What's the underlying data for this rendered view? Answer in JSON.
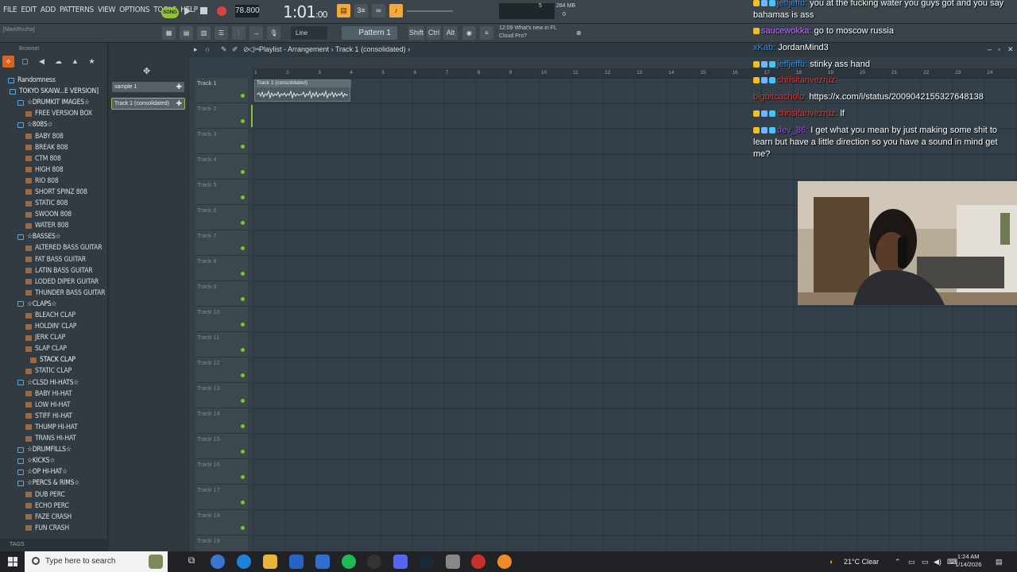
{
  "menu": [
    "FILE",
    "EDIT",
    "ADD",
    "PATTERNS",
    "VIEW",
    "OPTIONS",
    "TOOLS",
    "HELP"
  ],
  "transport": {
    "song_label": "SONG",
    "tempo": "78.800",
    "time": "1:01",
    "time_sub": ":00",
    "meter_value": "5",
    "memory": "284 MB",
    "meter_zero": "0"
  },
  "subbar": {
    "hint": "[MarkRocha]",
    "snap": "Line",
    "pattern": "Pattern 1",
    "key_shift": "Shift",
    "key_ctrl": "Ctrl",
    "key_alt": "Alt",
    "news_time": "12:09",
    "news_line1": "What's new in FL",
    "news_line2": "Cloud Pro?"
  },
  "browser": {
    "title": "Browser",
    "footer": "TAGS",
    "tree": [
      {
        "label": "Randomness",
        "type": "folder-root"
      },
      {
        "label": "TOKYO SKAIW...E VERSION]",
        "type": "folder"
      },
      {
        "label": "☆DRUMKIT IMAGES☆",
        "type": "folder"
      },
      {
        "label": "FREE VERSION BOX",
        "type": "item"
      },
      {
        "label": "☆808S☆",
        "type": "folder"
      },
      {
        "label": "BABY 808",
        "type": "item"
      },
      {
        "label": "BREAK 808",
        "type": "item"
      },
      {
        "label": "CTM 808",
        "type": "item"
      },
      {
        "label": "HIGH 808",
        "type": "item"
      },
      {
        "label": "RIO 808",
        "type": "item"
      },
      {
        "label": "SHORT SPINZ 808",
        "type": "item"
      },
      {
        "label": "STATIC 808",
        "type": "item"
      },
      {
        "label": "SWOON 808",
        "type": "item"
      },
      {
        "label": "WATER 808",
        "type": "item"
      },
      {
        "label": "☆BASSES☆",
        "type": "folder"
      },
      {
        "label": "ALTERED BASS GUITAR",
        "type": "item"
      },
      {
        "label": "FAT BASS GUITAR",
        "type": "item"
      },
      {
        "label": "LATIN BASS GUITAR",
        "type": "item"
      },
      {
        "label": "LODED DIPER GUITAR",
        "type": "item"
      },
      {
        "label": "THUNDER BASS GUITAR",
        "type": "item"
      },
      {
        "label": "☆CLAPS☆",
        "type": "folder"
      },
      {
        "label": "BLEACH CLAP",
        "type": "item"
      },
      {
        "label": "HOLDIN' CLAP",
        "type": "item"
      },
      {
        "label": "JERK CLAP",
        "type": "item"
      },
      {
        "label": "SLAP CLAP",
        "type": "item"
      },
      {
        "label": "STACK CLAP",
        "type": "item-selected"
      },
      {
        "label": "STATIC CLAP",
        "type": "item"
      },
      {
        "label": "☆CLSD HI-HATS☆",
        "type": "folder"
      },
      {
        "label": "BABY HI-HAT",
        "type": "item"
      },
      {
        "label": "LOW HI-HAT",
        "type": "item"
      },
      {
        "label": "STIFF HI-HAT",
        "type": "item"
      },
      {
        "label": "THUMP HI-HAT",
        "type": "item"
      },
      {
        "label": "TRANS HI-HAT",
        "type": "item"
      },
      {
        "label": "☆DRUMFILLS☆",
        "type": "folder"
      },
      {
        "label": "☆KICKS☆",
        "type": "folder"
      },
      {
        "label": "☆OP HI-HAT☆",
        "type": "folder"
      },
      {
        "label": "☆PERCS & RIMS☆",
        "type": "folder"
      },
      {
        "label": "DUB PERC",
        "type": "item"
      },
      {
        "label": "ECHO PERC",
        "type": "item"
      },
      {
        "label": "FAZE CRASH",
        "type": "item"
      },
      {
        "label": "FUN CRASH",
        "type": "item"
      }
    ]
  },
  "channels": [
    {
      "label": "sample 1"
    },
    {
      "label": "Track 1 (consolidated)"
    }
  ],
  "playlist": {
    "title": "Playlist - Arrangement",
    "breadcrumb": "Track 1 (consolidated)",
    "ruler": [
      "1",
      "2",
      "3",
      "4",
      "5",
      "6",
      "7",
      "8",
      "9",
      "10",
      "11",
      "12",
      "13",
      "14",
      "15",
      "16",
      "17",
      "18",
      "19",
      "20",
      "21",
      "22",
      "23",
      "24"
    ],
    "tracks": [
      "Track 1",
      "Track 2",
      "Track 3",
      "Track 4",
      "Track 5",
      "Track 6",
      "Track 7",
      "Track 8",
      "Track 9",
      "Track 10",
      "Track 11",
      "Track 12",
      "Track 13",
      "Track 14",
      "Track 15",
      "Track 16",
      "Track 17",
      "Track 18",
      "Track 19"
    ],
    "clip_label": "Track 1 (consolidated)"
  },
  "chat": [
    {
      "user": "jeffjeffb",
      "user_color": "#3a8fe0",
      "text": "you at the fucking water you guys got and you say bahamas is ass"
    },
    {
      "user": "saucewokka",
      "user_color": "#c070ff",
      "text": "go to moscow russia"
    },
    {
      "user": "xKab",
      "user_color": "#3a8fe0",
      "text": "JordanMind3"
    },
    {
      "user": "jeffjeffb",
      "user_color": "#3a8fe0",
      "text": "stinky ass hand"
    },
    {
      "user": "chrisitanvezruz",
      "user_color": "#d23c3c",
      "text": ""
    },
    {
      "user": "bigbitcacholo",
      "user_color": "#d23c3c",
      "text": "https://x.com/i/status/2009042155327648138"
    },
    {
      "user": "chrisitanvezruz",
      "user_color": "#d23c3c",
      "text": "lf"
    },
    {
      "user": "dev_86",
      "user_color": "#9b4de0",
      "text": "I get what you mean by just making some shit to learn but have a little direction so you have a sound in mind get me?"
    }
  ],
  "taskbar": {
    "search_placeholder": "Type here to search",
    "weather": "21°C  Clear",
    "time": "1:24 AM",
    "date": "1/14/2026"
  },
  "colors": {
    "accent_green": "#8fc43a",
    "accent_orange": "#d9641d",
    "rec_red": "#d8443c"
  }
}
